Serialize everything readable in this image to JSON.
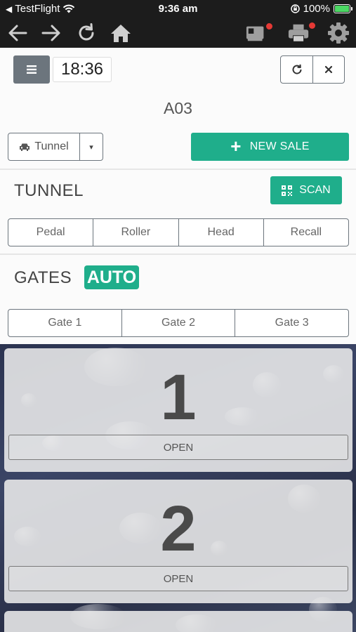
{
  "status_bar": {
    "carrier": "TestFlight",
    "time": "9:36 am",
    "battery": "100%"
  },
  "browser_toolbar": {
    "icons": [
      "back-arrow-icon",
      "forward-arrow-icon",
      "reload-icon",
      "home-icon",
      "card-reader-icon",
      "printer-icon",
      "gear-icon"
    ],
    "notification_color": "#e53935"
  },
  "header": {
    "menu_icon": "≡",
    "clock": "18:36",
    "refresh_icon": "↻",
    "close_icon": "×"
  },
  "device_id": "A03",
  "mode_select": {
    "selected": "Tunnel",
    "caret": "▾"
  },
  "new_sale": {
    "label": "NEW SALE",
    "icon": "+"
  },
  "tunnel": {
    "title": "TUNNEL",
    "scan_label": "SCAN",
    "buttons": [
      "Pedal",
      "Roller",
      "Head",
      "Recall"
    ]
  },
  "gates": {
    "title": "GATES",
    "auto_badge": "AUTO",
    "buttons": [
      "Gate 1",
      "Gate 2",
      "Gate 3"
    ]
  },
  "gate_cards": [
    {
      "number": "1",
      "action": "OPEN"
    },
    {
      "number": "2",
      "action": "OPEN"
    }
  ],
  "colors": {
    "accent": "#1fae8b",
    "dark_bar": "#1c1c1c",
    "secondary": "#6c757d"
  }
}
